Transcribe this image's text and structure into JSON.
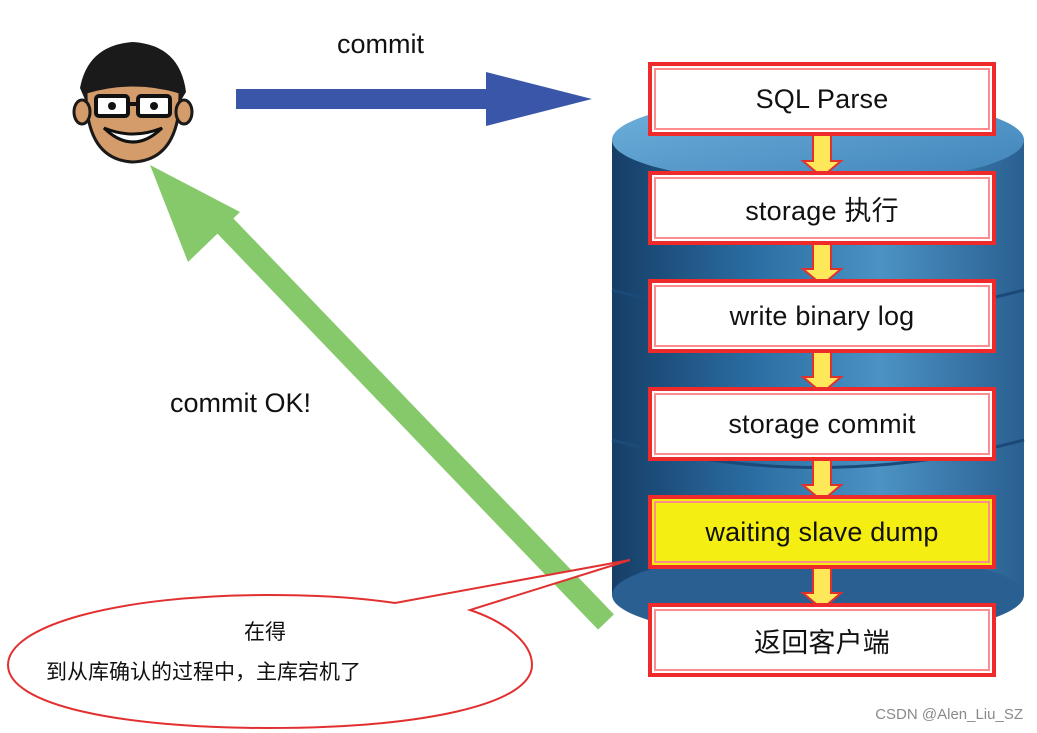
{
  "labels": {
    "commit": "commit",
    "commit_ok": "commit OK!"
  },
  "steps": [
    {
      "label": "SQL Parse"
    },
    {
      "label": "storage 执行"
    },
    {
      "label": "write binary log"
    },
    {
      "label": "storage commit"
    },
    {
      "label": "waiting slave dump"
    },
    {
      "label": "返回客户端"
    }
  ],
  "bubble": {
    "line1": "在得",
    "line2": "到从库确认的过程中，主库宕机了"
  },
  "watermark": "CSDN @Alen_Liu_SZ",
  "colors": {
    "step_border": "#ee2a2a",
    "highlight_fill": "#f4ee12",
    "db_blue": "#2c6da0",
    "commit_arrow": "#3a56a8",
    "return_arrow": "#86c96a",
    "step_arrow_fill": "#fde85a"
  },
  "icons": {
    "user": "nerd-face-icon",
    "database": "database-cylinder-icon"
  }
}
